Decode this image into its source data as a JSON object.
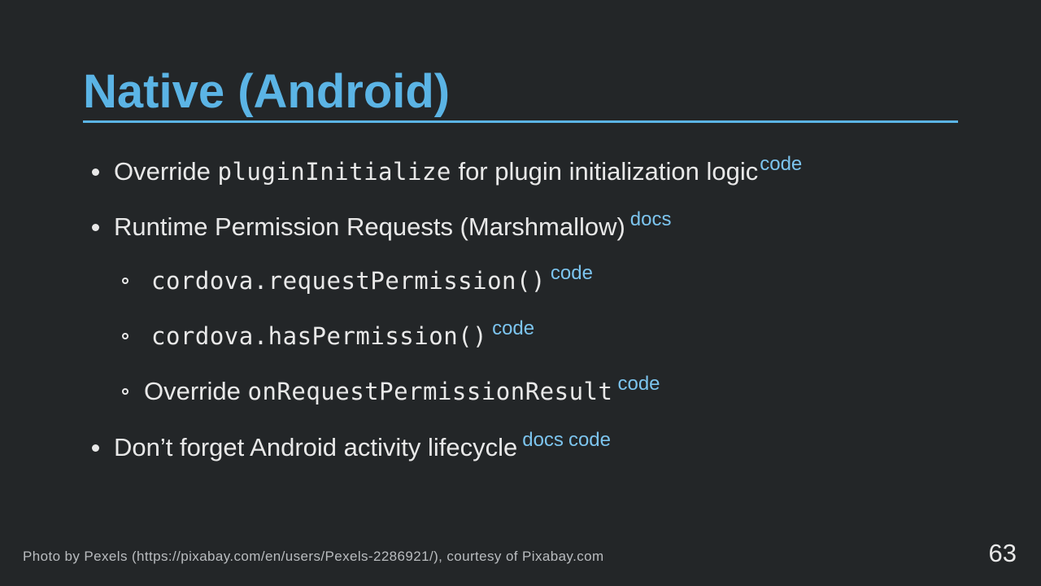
{
  "slide": {
    "title": "Native (Android)",
    "bullets": [
      {
        "pre": "Override ",
        "code": "pluginInitialize",
        "post": " for plugin initialization logic",
        "links": [
          "code"
        ]
      },
      {
        "pre": "Runtime Permission Requests (Marshmallow)",
        "links": [
          "docs"
        ]
      },
      {
        "code": "cordova.requestPermission()",
        "links": [
          "code"
        ]
      },
      {
        "code": "cordova.hasPermission()",
        "links": [
          "code"
        ]
      },
      {
        "pre": "Override ",
        "code": "onRequestPermissionResult",
        "links": [
          "code"
        ]
      },
      {
        "pre": "Don’t forget Android activity lifecycle",
        "links": [
          "docs",
          "code"
        ]
      }
    ],
    "footer_credit": "Photo by Pexels (https://pixabay.com/en/users/Pexels-2286921/), courtesy of Pixabay.com",
    "page_number": "63"
  },
  "colors": {
    "background": "#232628",
    "accent": "#5bb4e5",
    "link": "#7cc4ee",
    "text": "#e8e8e8"
  }
}
